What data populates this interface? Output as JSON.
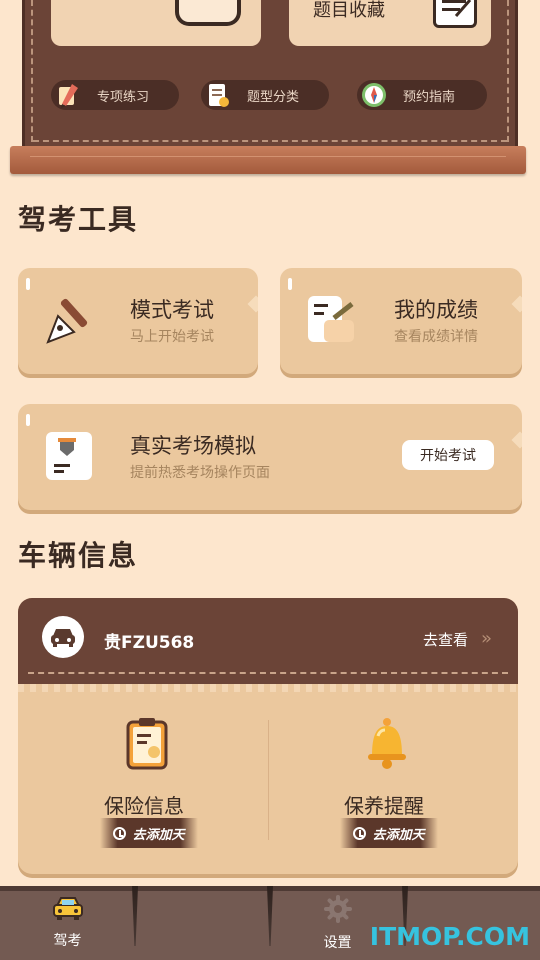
{
  "top_cards": {
    "right_label": "题目收藏"
  },
  "pills": [
    {
      "label": "专项练习",
      "icon": "pencil-icon"
    },
    {
      "label": "题型分类",
      "icon": "document-icon"
    },
    {
      "label": "预约指南",
      "icon": "compass-icon"
    }
  ],
  "tools_section": {
    "title": "驾考工具",
    "mock_exam": {
      "title": "模式考试",
      "subtitle": "马上开始考试",
      "icon": "pen-nib-icon"
    },
    "my_scores": {
      "title": "我的成绩",
      "subtitle": "查看成绩详情",
      "icon": "scorecard-icon"
    },
    "real_exam": {
      "title": "真实考场模拟",
      "subtitle": "提前热悉考场操作页面",
      "button": "开始考试",
      "icon": "exam-paper-icon"
    }
  },
  "vehicle_section": {
    "title": "车辆信息",
    "plate": "贵FZU568",
    "view_link": "去查看",
    "items": [
      {
        "label": "保险信息",
        "button": "去添加天",
        "icon": "insurance-clipboard-icon"
      },
      {
        "label": "保养提醒",
        "button": "去添加天",
        "icon": "bell-icon"
      }
    ]
  },
  "nav": {
    "items": [
      {
        "label": "驾考",
        "icon": "car-icon",
        "active": true
      },
      {
        "label": "",
        "icon": "",
        "active": false
      },
      {
        "label": "设置",
        "icon": "gear-icon",
        "active": false
      },
      {
        "label": "",
        "icon": "",
        "active": false
      }
    ]
  },
  "watermark": "ITMOP.COM",
  "colors": {
    "background": "#fde6cd",
    "board": "#6b4437",
    "card": "#ebc89e",
    "nav": "#735a52",
    "watermark": "#36c3df"
  }
}
